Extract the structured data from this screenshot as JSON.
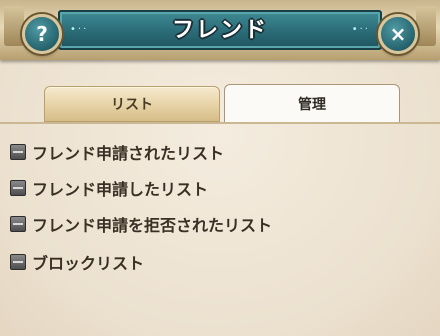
{
  "header": {
    "title": "フレンド",
    "help_icon_glyph": "?",
    "close_icon_glyph": "×",
    "dots": "•··"
  },
  "tabs": [
    {
      "label": "リスト",
      "active": false
    },
    {
      "label": "管理",
      "active": true
    }
  ],
  "menu": {
    "items": [
      {
        "label": "フレンド申請されたリスト"
      },
      {
        "label": "フレンド申請したリスト"
      },
      {
        "label": "フレンド申請を拒否されたリスト"
      },
      {
        "label": "ブロックリスト"
      }
    ]
  },
  "colors": {
    "panel_bg": "#efe6d6",
    "title_bar": "#2c6e79",
    "text": "#3a2f24"
  }
}
